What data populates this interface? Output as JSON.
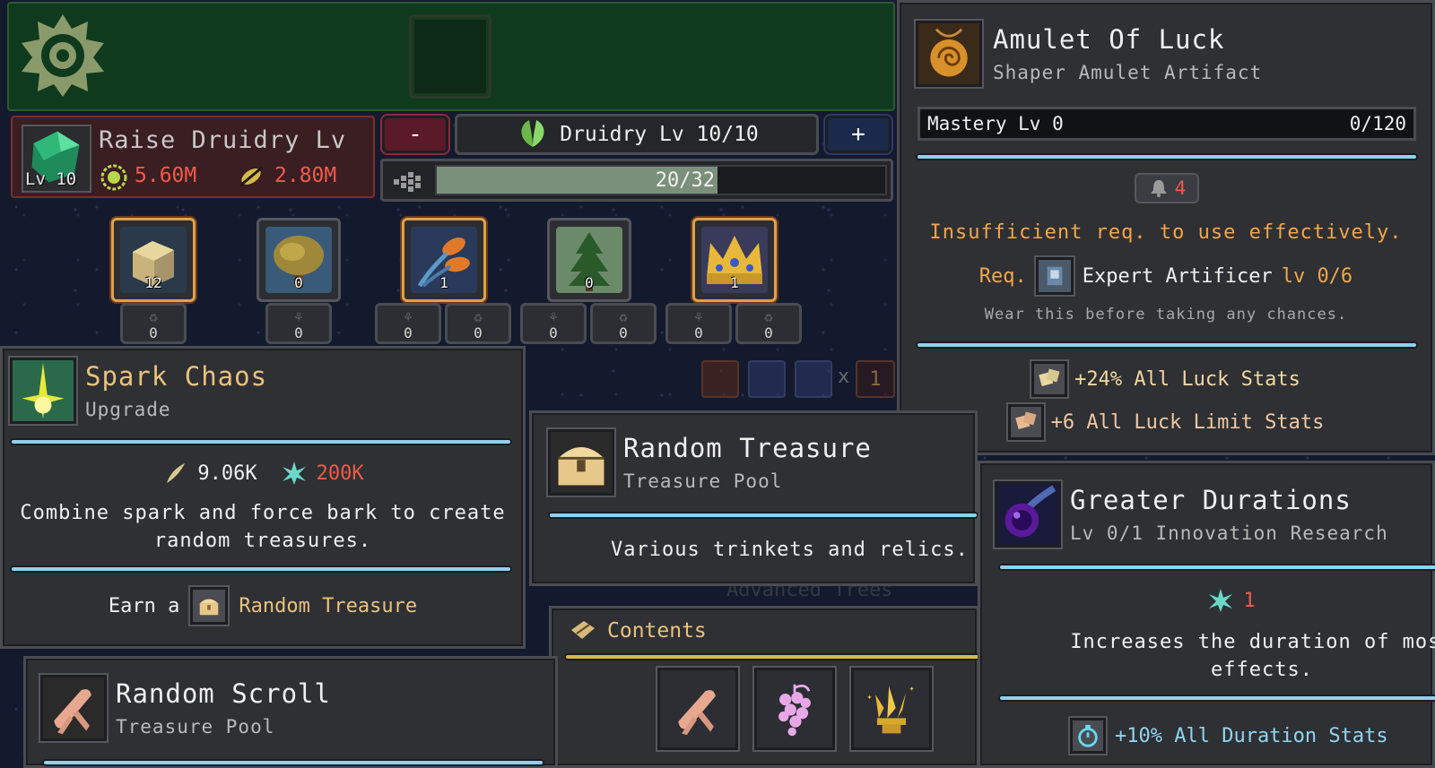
{
  "top": {
    "raise": {
      "label": "Raise Druidry Lv",
      "level": "Lv 10",
      "cost1": "5.60M",
      "cost2": "2.80M"
    },
    "minus": "-",
    "plus": "+",
    "druidry": "Druidry Lv 10/10",
    "progress": {
      "text": "20/32",
      "value": 20,
      "max": 32
    },
    "slots": [
      {
        "name": "crate",
        "count": "12",
        "active": true,
        "subs": [
          "0"
        ]
      },
      {
        "name": "tree",
        "count": "0",
        "active": false,
        "subs": [
          "0"
        ]
      },
      {
        "name": "bulbs",
        "count": "1",
        "active": true,
        "subs": [
          "0",
          "0"
        ]
      },
      {
        "name": "pine",
        "count": "0",
        "active": false,
        "subs": [
          "0",
          "0"
        ]
      },
      {
        "name": "crown",
        "count": "1",
        "active": true,
        "subs": [
          "0",
          "0"
        ]
      }
    ],
    "multiplier_x": "x",
    "multiplier_val": "1"
  },
  "amulet": {
    "title": "Amulet Of Luck",
    "subtitle": "Shaper Amulet Artifact",
    "mastery_label": "Mastery Lv 0",
    "mastery_value": "0/120",
    "req_count": "4",
    "warning": "Insufficient req. to use effectively.",
    "req_prefix": "Req.",
    "req_name": "Expert Artificer",
    "req_level": "lv 0/6",
    "flavor": "Wear this before taking any chances.",
    "stat1": "+24% All Luck Stats",
    "stat2": "+6 All Luck Limit Stats"
  },
  "spark": {
    "title": "Spark Chaos",
    "subtitle": "Upgrade",
    "cost1": "9.06K",
    "cost2": "200K",
    "desc": "Combine spark and force bark to create random treasures.",
    "earn_prefix": "Earn a",
    "earn_item": "Random Treasure"
  },
  "treasure": {
    "title": "Random Treasure",
    "subtitle": "Treasure Pool",
    "desc": "Various trinkets and relics."
  },
  "contents": {
    "label": "Contents",
    "items": [
      "scroll",
      "grapes",
      "crystal"
    ]
  },
  "bg_text": "Advanced Trees",
  "durations": {
    "title": "Greater Durations",
    "subtitle": "Lv 0/1 Innovation Research",
    "cost": "1",
    "desc": "Increases the duration of most effects.",
    "stat": "+10% All Duration Stats"
  },
  "scroll": {
    "title": "Random Scroll",
    "subtitle": "Treasure Pool"
  },
  "colors": {
    "accent_blue": "#8fd0ee",
    "warning_orange": "#f0a64a",
    "cost_red": "#f25a4a",
    "gold": "#e9c27d",
    "header_green": "#0f3a1e"
  }
}
